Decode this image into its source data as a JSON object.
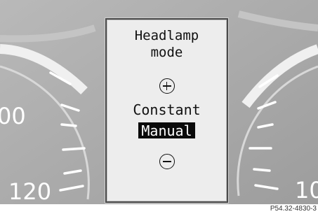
{
  "display": {
    "title_line1": "Headlamp",
    "title_line2": "mode",
    "increase_icon": "plus-circle-icon",
    "option_unselected": "Constant",
    "option_selected": "Manual",
    "decrease_icon": "minus-circle-icon"
  },
  "gauges": {
    "left_upper_label": "00",
    "left_lower_label": "120",
    "right_lower_label": "10"
  },
  "caption": "P54.32-4830-3",
  "colors": {
    "gauge_face": "#a9a9a9",
    "screen_background": "#ededed",
    "selection_highlight": "#0a0a0a",
    "text": "#111111"
  }
}
